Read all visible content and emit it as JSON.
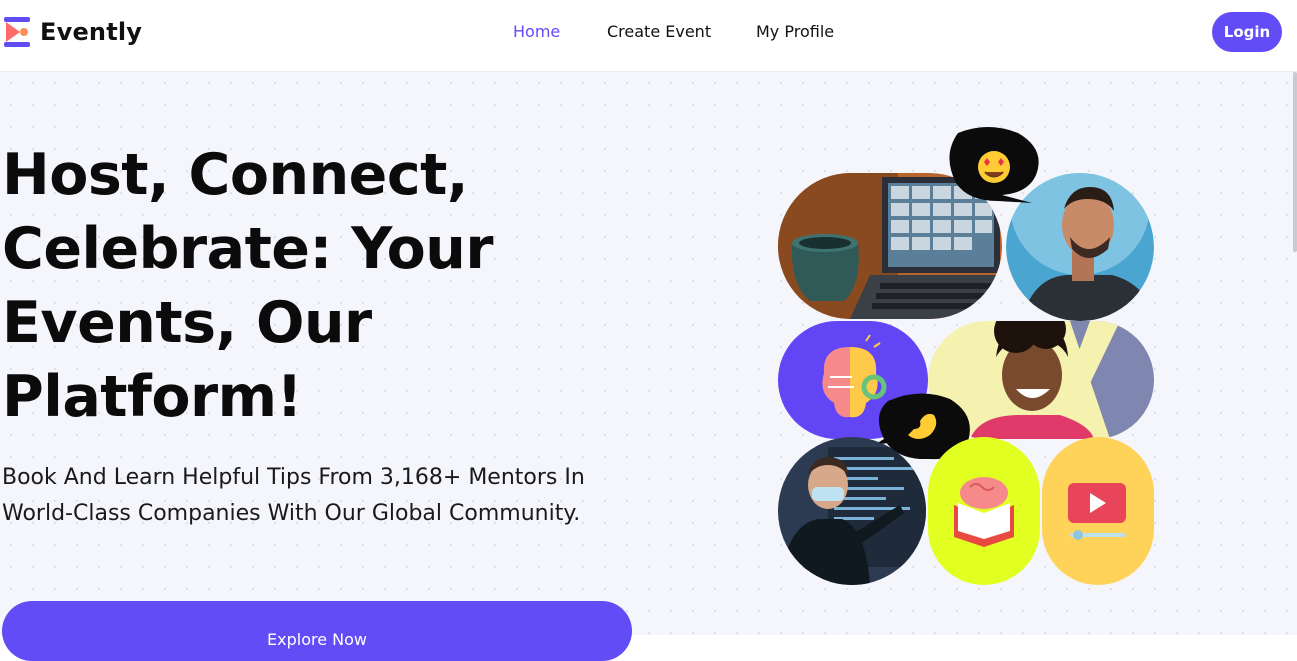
{
  "brand": {
    "name": "Evently",
    "accent": "#624cf5",
    "logo_colors": [
      "#ff6b6b",
      "#624cf5"
    ]
  },
  "nav": [
    {
      "label": "Home",
      "active": true
    },
    {
      "label": "Create Event",
      "active": false
    },
    {
      "label": "My Profile",
      "active": false
    }
  ],
  "header": {
    "login_label": "Login"
  },
  "hero": {
    "title": "Host, Connect, Celebrate: Your Events, Our Platform!",
    "subtitle": "Book And Learn Helpful Tips From 3,168+ Mentors In World-Class Companies With Our Global Community.",
    "cta_label": "Explore Now"
  },
  "collage": {
    "tiles": [
      {
        "icon": "laptop-video-call-photo"
      },
      {
        "icon": "smiling-man-photo"
      },
      {
        "icon": "brain-idea-icon"
      },
      {
        "icon": "laughing-woman-photo"
      },
      {
        "icon": "presenter-photo"
      },
      {
        "icon": "brain-book-icon"
      },
      {
        "icon": "video-play-icon"
      }
    ],
    "emoji_bubbles": [
      {
        "icon": "heart-eyes-emoji"
      },
      {
        "icon": "pinching-hand-emoji"
      }
    ]
  }
}
